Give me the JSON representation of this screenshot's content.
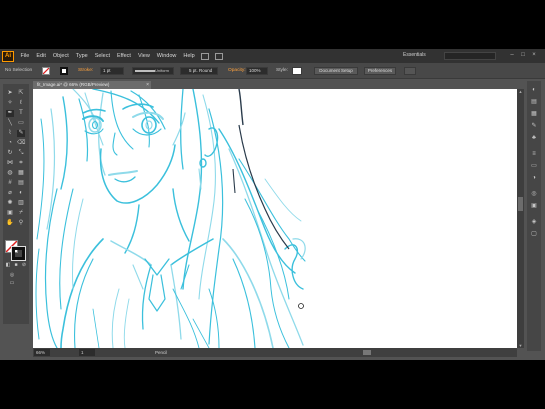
{
  "app": {
    "logo_text": "Ai"
  },
  "menu": {
    "items": [
      "File",
      "Edit",
      "Object",
      "Type",
      "Select",
      "Effect",
      "View",
      "Window",
      "Help"
    ],
    "workspace": "Essentials",
    "search_placeholder": ""
  },
  "control_bar": {
    "selection_label": "No Selection",
    "stroke_label": "Stroke:",
    "stroke_value": "1 pt",
    "profile_label": "Uniform",
    "brush_label": "5 pt. Round",
    "opacity_label": "Opacity:",
    "opacity_value": "100%",
    "style_label": "Style:",
    "doc_setup_button": "Document Setup",
    "preferences_button": "Preferences"
  },
  "document_tab": {
    "title": "fit_Image.ai* @ 66% (RGB/Preview)"
  },
  "status_bar": {
    "zoom": "66%",
    "artboard": "1",
    "tool_name": "Pencil"
  },
  "colors": {
    "sketch": "#3bc0dc",
    "sketch_light": "#8fdaea",
    "ink": "#2a3b4b",
    "accent_orange": "#ff9a00"
  },
  "tools": [
    "selection-tool",
    "direct-selection-tool",
    "magic-wand-tool",
    "lasso-tool",
    "pen-tool",
    "type-tool",
    "line-tool",
    "rectangle-tool",
    "paintbrush-tool",
    "pencil-tool",
    "blob-brush-tool",
    "eraser-tool",
    "rotate-tool",
    "scale-tool",
    "width-tool",
    "free-transform-tool",
    "shape-builder-tool",
    "perspective-grid-tool",
    "mesh-tool",
    "gradient-tool",
    "eyedropper-tool",
    "blend-tool",
    "symbol-sprayer-tool",
    "column-graph-tool",
    "artboard-tool",
    "slice-tool",
    "hand-tool",
    "zoom-tool"
  ],
  "dock_icons": [
    "color-panel-icon",
    "color-guide-icon",
    "swatches-icon",
    "brushes-icon",
    "symbols-icon",
    "stroke-icon",
    "gradient-icon",
    "transparency-icon",
    "appearance-icon",
    "graphic-styles-icon",
    "layers-icon",
    "artboards-icon"
  ]
}
